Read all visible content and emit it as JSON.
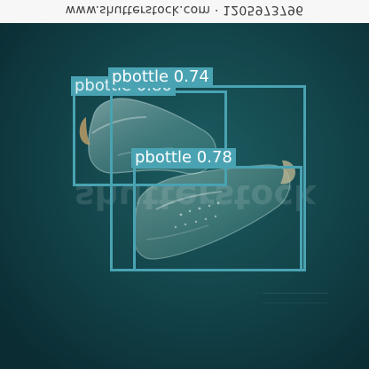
{
  "banner": {
    "text": "www.shutterstock.com · 1205973796"
  },
  "watermark": {
    "text": "shutterstock"
  },
  "detections": [
    {
      "label": "pbottle 0.80"
    },
    {
      "label": "pbottle 0.74"
    },
    {
      "label": "pbottle 0.78"
    }
  ],
  "colors": {
    "water": "#0f3f45",
    "box": "#4aa3b2",
    "banner": "#f7f7f7"
  }
}
